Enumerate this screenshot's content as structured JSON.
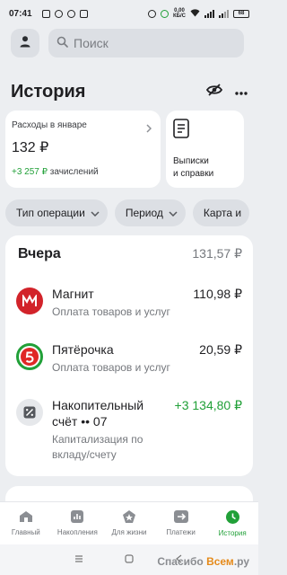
{
  "status_bar": {
    "time": "07:41",
    "network_line1": "0,00",
    "network_line2": "КБ/С",
    "battery": "68"
  },
  "search": {
    "placeholder": "Поиск"
  },
  "page": {
    "title": "История"
  },
  "expenses_card": {
    "label": "Расходы в январе",
    "amount": "132 ₽",
    "income_amount": "+3 257 ₽",
    "income_label": "зачислений"
  },
  "statements_card": {
    "line1": "Выписки",
    "line2": "и справки"
  },
  "filters": [
    {
      "label": "Тип операции"
    },
    {
      "label": "Период"
    },
    {
      "label": "Карта и"
    }
  ],
  "history": {
    "day": "Вчера",
    "day_total": "131,57 ₽",
    "transactions": [
      {
        "name": "Магнит",
        "description": "Оплата товаров и услуг",
        "amount": "110,98 ₽",
        "logo": "magnit-logo",
        "color": "#D2232A"
      },
      {
        "name": "Пятёрочка",
        "description": "Оплата товаров и услуг",
        "amount": "20,59 ₽",
        "logo": "pyaterochka-logo",
        "color": "#E02826"
      },
      {
        "name_line1": "Накопительный",
        "name_line2": "счёт •• 07",
        "description_line1": "Капитализация по",
        "description_line2": "вкладу/счету",
        "amount": "+3 134,80 ₽",
        "logo": "percent-icon"
      }
    ]
  },
  "tabbar": [
    {
      "label": "Главный",
      "icon": "home-icon"
    },
    {
      "label": "Накопления",
      "icon": "chart-icon"
    },
    {
      "label": "Для жизни",
      "icon": "star-icon"
    },
    {
      "label": "Платежи",
      "icon": "transfer-icon"
    },
    {
      "label": "История",
      "icon": "clock-icon",
      "active": true
    }
  ],
  "watermark": {
    "text_a": "Спасибо ",
    "text_b": "Всем",
    "text_c": ".ру"
  },
  "colors": {
    "accent": "#21A038",
    "background": "#ECEEF1",
    "card": "#FFFFFF",
    "muted": "#75787D"
  }
}
